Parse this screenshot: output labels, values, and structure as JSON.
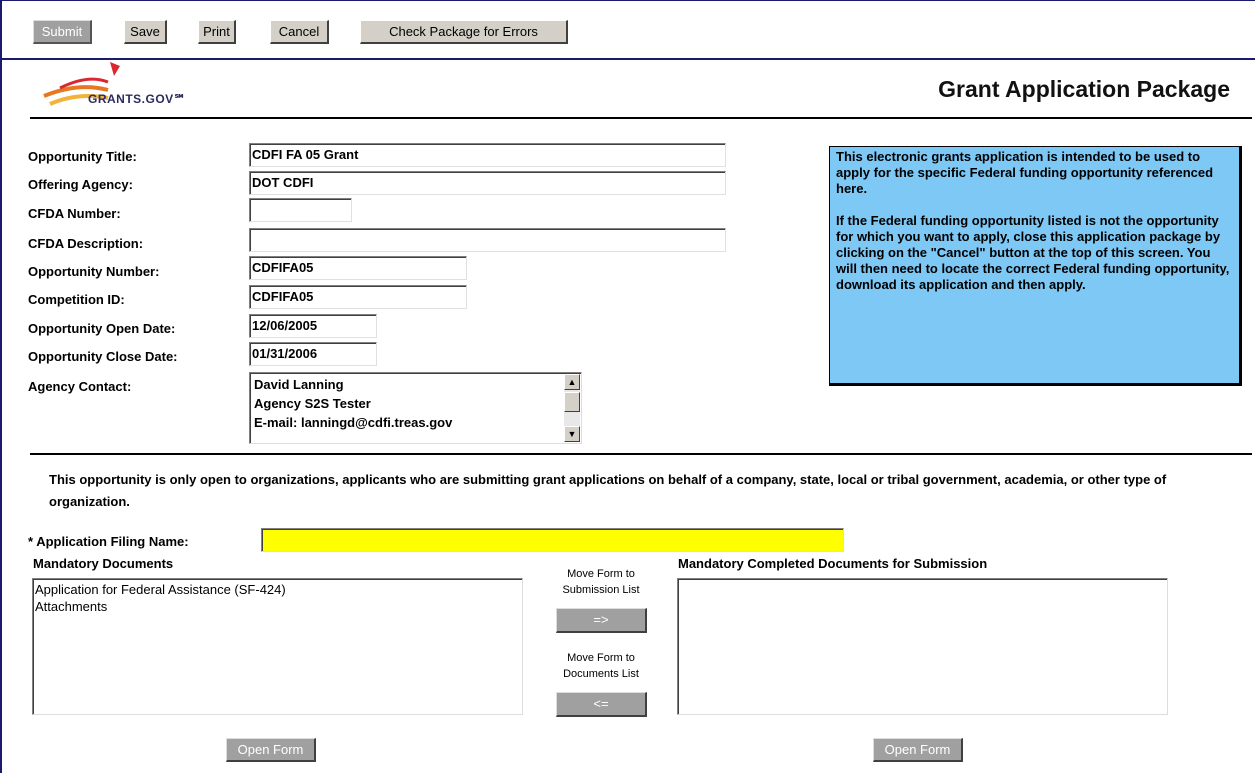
{
  "toolbar": {
    "submit": "Submit",
    "save": "Save",
    "print": "Print",
    "cancel": "Cancel",
    "check": "Check Package for Errors"
  },
  "header": {
    "logo_text": "GRANTS.GOV℠",
    "title": "Grant Application Package"
  },
  "fields": {
    "opportunity_title": {
      "label": "Opportunity Title:",
      "value": "CDFI FA 05 Grant"
    },
    "offering_agency": {
      "label": "Offering Agency:",
      "value": "DOT CDFI"
    },
    "cfda_number": {
      "label": "CFDA Number:",
      "value": ""
    },
    "cfda_description": {
      "label": "CFDA Description:",
      "value": ""
    },
    "opportunity_number": {
      "label": "Opportunity Number:",
      "value": "CDFIFA05"
    },
    "competition_id": {
      "label": "Competition ID:",
      "value": "CDFIFA05"
    },
    "open_date": {
      "label": "Opportunity Open Date:",
      "value": "12/06/2005"
    },
    "close_date": {
      "label": "Opportunity Close Date:",
      "value": "01/31/2006"
    },
    "agency_contact": {
      "label": "Agency Contact:",
      "line1": "David Lanning",
      "line2": "Agency S2S Tester",
      "line3": "E-mail: lanningd@cdfi.treas.gov"
    }
  },
  "info_box": {
    "para1": "This electronic grants application is intended to be used to apply for the specific Federal funding opportunity referenced here.",
    "para2": "If the Federal funding opportunity listed is not the opportunity for which you want to apply, close this application package by clicking on the \"Cancel\" button at the top of this screen. You will then need to locate the correct Federal funding opportunity, download its application and then apply."
  },
  "notice": "This opportunity is only open to organizations, applicants who are submitting grant applications on behalf of a company, state, local or tribal government, academia, or other type of organization.",
  "filing_name": {
    "label": "* Application Filing Name:",
    "value": ""
  },
  "mandatory_documents": {
    "title": "Mandatory Documents",
    "items": [
      "Application for Federal Assistance (SF-424)",
      "Attachments"
    ]
  },
  "completed_documents": {
    "title": "Mandatory Completed Documents for Submission",
    "items": []
  },
  "move_controls": {
    "to_submission_line1": "Move Form to",
    "to_submission_line2": "Submission List",
    "to_submission_button": "=>",
    "to_documents_line1": "Move Form to",
    "to_documents_line2": "Documents List",
    "to_documents_button": "<="
  },
  "open_form_left": "Open Form",
  "open_form_right": "Open Form"
}
